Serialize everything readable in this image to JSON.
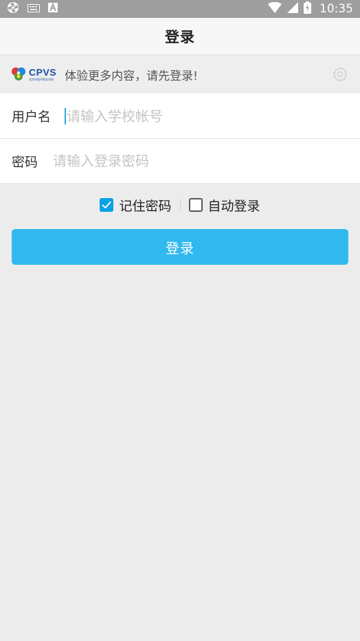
{
  "status_bar": {
    "time": "10:35",
    "icons": [
      "aperture-icon",
      "keyboard-icon",
      "a-icon",
      "wifi-icon",
      "signal-icon",
      "battery-icon"
    ]
  },
  "header": {
    "title": "登录"
  },
  "notice": {
    "logo_text": "CPVS",
    "logo_subtext": "北京市昌平职业学校",
    "message": "体验更多内容，请先登录!",
    "icon": "gear-icon"
  },
  "form": {
    "username": {
      "label": "用户名",
      "value": "",
      "placeholder": "请输入学校帐号"
    },
    "password": {
      "label": "密码",
      "value": "",
      "placeholder": "请输入登录密码"
    }
  },
  "options": {
    "remember_password": {
      "label": "记住密码",
      "checked": true
    },
    "auto_login": {
      "label": "自动登录",
      "checked": false
    }
  },
  "login_button": {
    "label": "登录"
  },
  "colors": {
    "accent": "#31b9ef",
    "checkbox_checked": "#0aa1e6",
    "status_bar": "#9e9e9e",
    "page_background": "#ececec",
    "logo_blue": "#1b4f9c"
  }
}
